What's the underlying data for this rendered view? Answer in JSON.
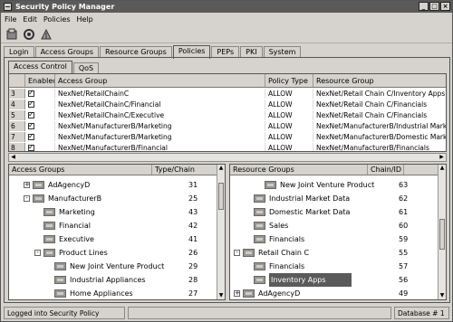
{
  "window": {
    "title": "Security Policy Manager"
  },
  "menu": [
    "File",
    "Edit",
    "Policies",
    "Help"
  ],
  "toolbar": {
    "icons": [
      "open-icon",
      "refresh-icon",
      "policy-tool-icon"
    ]
  },
  "tabs": [
    "Login",
    "Access Groups",
    "Resource Groups",
    "Policies",
    "PEPs",
    "PKI",
    "System"
  ],
  "active_tab": "Policies",
  "subtabs": [
    "Access Control",
    "QoS"
  ],
  "active_subtab": "Access Control",
  "policy_table": {
    "columns": [
      "",
      "Enabled",
      "Access Group",
      "Policy Type",
      "Resource Group"
    ],
    "rows": [
      {
        "num": "3",
        "enabled": true,
        "access_group": "NexNet/RetailChainC",
        "policy_type": "ALLOW",
        "resource_group": "NexNet/Retail Chain C/Inventory Apps"
      },
      {
        "num": "4",
        "enabled": true,
        "access_group": "NexNet/RetailChainC/Financial",
        "policy_type": "ALLOW",
        "resource_group": "NexNet/Retail Chain C/Financials"
      },
      {
        "num": "5",
        "enabled": true,
        "access_group": "NexNet/RetailChainC/Executive",
        "policy_type": "ALLOW",
        "resource_group": "NexNet/Retail Chain C/Financials"
      },
      {
        "num": "6",
        "enabled": true,
        "access_group": "NexNet/ManufacturerB/Marketing",
        "policy_type": "ALLOW",
        "resource_group": "NexNet/ManufacturerB/Industrial Marke"
      },
      {
        "num": "7",
        "enabled": true,
        "access_group": "NexNet/ManufacturerB/Marketing",
        "policy_type": "ALLOW",
        "resource_group": "NexNet/ManufacturerB/Domestic Mark"
      },
      {
        "num": "8",
        "enabled": true,
        "access_group": "NexNet/ManufacturerB/Financial",
        "policy_type": "ALLOW",
        "resource_group": "NexNet/ManufacturerB/Financials"
      }
    ]
  },
  "access_groups": {
    "headers": [
      "Access Groups",
      "Type/Chain"
    ],
    "items": [
      {
        "label": "AdAgencyD",
        "value": "31",
        "level": 1,
        "toggle": "+"
      },
      {
        "label": "ManufacturerB",
        "value": "25",
        "level": 1,
        "toggle": "-"
      },
      {
        "label": "Marketing",
        "value": "43",
        "level": 2,
        "toggle": ""
      },
      {
        "label": "Financial",
        "value": "42",
        "level": 2,
        "toggle": ""
      },
      {
        "label": "Executive",
        "value": "41",
        "level": 2,
        "toggle": ""
      },
      {
        "label": "Product Lines",
        "value": "26",
        "level": 2,
        "toggle": "-"
      },
      {
        "label": "New Joint Venture Product",
        "value": "29",
        "level": 3,
        "toggle": ""
      },
      {
        "label": "Industrial Appliances",
        "value": "28",
        "level": 3,
        "toggle": ""
      },
      {
        "label": "Home Appliances",
        "value": "27",
        "level": 3,
        "toggle": ""
      }
    ]
  },
  "resource_groups": {
    "headers": [
      "Resource Groups",
      "Chain/ID"
    ],
    "items": [
      {
        "label": "New Joint Venture Product",
        "value": "63",
        "level": 2,
        "toggle": ""
      },
      {
        "label": "Industrial Market Data",
        "value": "62",
        "level": 1,
        "toggle": ""
      },
      {
        "label": "Domestic Market Data",
        "value": "61",
        "level": 1,
        "toggle": ""
      },
      {
        "label": "Sales",
        "value": "60",
        "level": 1,
        "toggle": ""
      },
      {
        "label": "Financials",
        "value": "59",
        "level": 1,
        "toggle": ""
      },
      {
        "label": "Retail Chain C",
        "value": "55",
        "level": 0,
        "toggle": "-"
      },
      {
        "label": "Financials",
        "value": "57",
        "level": 1,
        "toggle": ""
      },
      {
        "label": "Inventory Apps",
        "value": "56",
        "level": 1,
        "toggle": "",
        "selected": true
      },
      {
        "label": "AdAgencyD",
        "value": "49",
        "level": 0,
        "toggle": "+"
      }
    ]
  },
  "status": {
    "message": "Logged into Security Policy Manager",
    "database": "Database # 1"
  }
}
